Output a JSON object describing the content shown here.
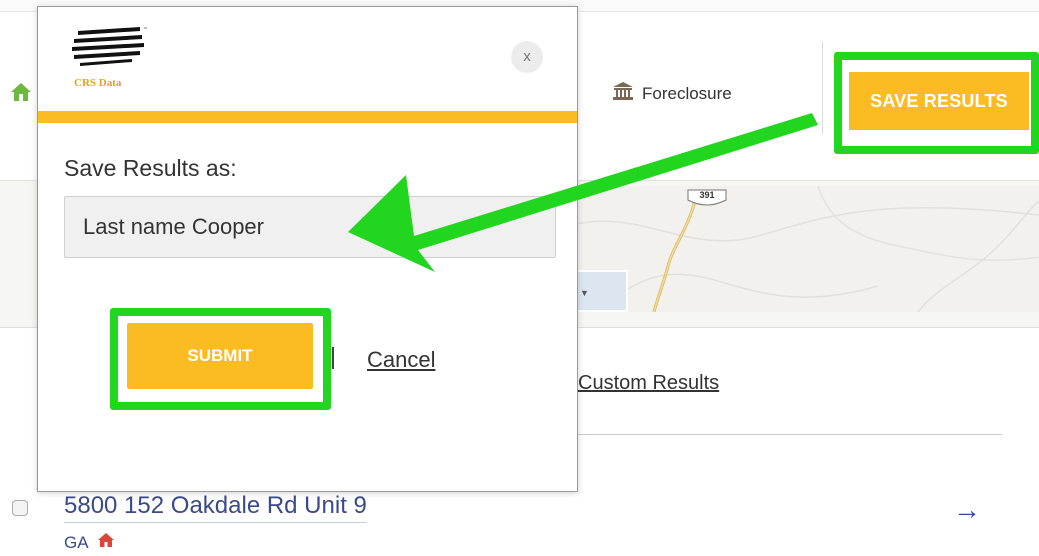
{
  "app": {
    "foreclosure_label": "Foreclosure",
    "save_results_label": "SAVE RESULTS",
    "custom_results_label": "Custom Results"
  },
  "modal": {
    "logo_text": "CRS Data",
    "close_label": "x",
    "label": "Save Results as:",
    "input_value": "Last name Cooper",
    "submit_label": "SUBMIT",
    "separator": "|",
    "cancel_label": "Cancel"
  },
  "map": {
    "road_shield": "391"
  },
  "listing": {
    "address": "5800 152 Oakdale Rd Unit 9",
    "state": "GA",
    "arrow": "→"
  },
  "colors": {
    "accent": "#fbbc23",
    "highlight": "#22d61f",
    "link": "#3a4a8a"
  },
  "icons": [
    "home-icon",
    "bank-icon",
    "close-icon",
    "house-red-icon",
    "arrow-right-icon"
  ]
}
